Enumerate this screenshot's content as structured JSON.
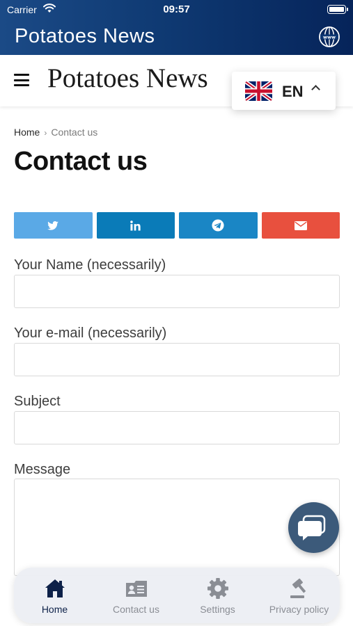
{
  "status_bar": {
    "carrier": "Carrier",
    "time": "09:57"
  },
  "app_bar": {
    "title": "Potatoes News"
  },
  "site_header": {
    "logo": "Potatoes News",
    "language": {
      "code": "EN",
      "flag": "uk-flag"
    }
  },
  "breadcrumb": {
    "home": "Home",
    "current": "Contact us"
  },
  "page": {
    "title": "Contact us"
  },
  "share": {
    "buttons": [
      {
        "icon": "twitter-icon",
        "color": "#5aa9e6"
      },
      {
        "icon": "linkedin-icon",
        "color": "#0a7bb8"
      },
      {
        "icon": "telegram-icon",
        "color": "#1a86c5"
      },
      {
        "icon": "email-icon",
        "color": "#e8503e"
      }
    ]
  },
  "form": {
    "name_label": "Your Name (necessarily)",
    "name_value": "",
    "email_label": "Your e-mail (necessarily)",
    "email_value": "",
    "subject_label": "Subject",
    "subject_value": "",
    "message_label": "Message",
    "message_value": ""
  },
  "chat": {
    "icon": "chat-bubble-icon",
    "color": "#3c5a7a"
  },
  "bottom_nav": {
    "items": [
      {
        "label": "Home",
        "icon": "home-icon",
        "active": true
      },
      {
        "label": "Contact us",
        "icon": "contact-card-icon",
        "active": false
      },
      {
        "label": "Settings",
        "icon": "gear-icon",
        "active": false
      },
      {
        "label": "Privacy policy",
        "icon": "gavel-icon",
        "active": false
      }
    ],
    "active_color": "#0d2148",
    "inactive_color": "#8a8d94"
  }
}
